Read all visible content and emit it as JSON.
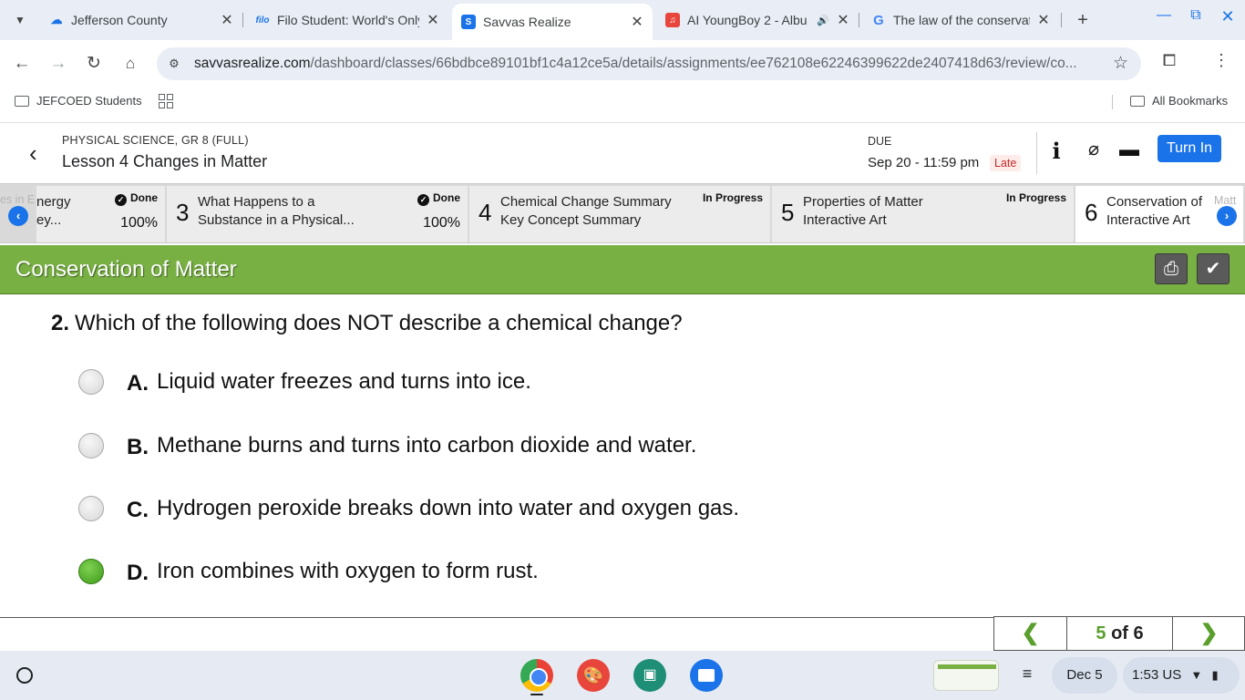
{
  "browser": {
    "tabs": [
      {
        "title": "Jefferson County",
        "favicon": "cloud-icon",
        "favicon_color": "#1a73e8",
        "active": false
      },
      {
        "title": "Filo Student: World's Only",
        "favicon": "filo-icon",
        "favicon_text": "filo",
        "favicon_color": "#1a73e8",
        "active": false
      },
      {
        "title": "Savvas Realize",
        "favicon": "savvas-icon",
        "favicon_text": "S",
        "favicon_color": "#1a73e8",
        "active": true
      },
      {
        "title": "AI YoungBoy 2 - Albu",
        "favicon": "music-icon",
        "favicon_color": "#e8453c",
        "active": false,
        "audio": true
      },
      {
        "title": "The law of the conservat",
        "favicon": "google-icon",
        "favicon_text": "G",
        "favicon_color": "#4285f4",
        "active": false
      }
    ],
    "new_tab": "+",
    "url_host": "savvasrealize.com",
    "url_path": "/dashboard/classes/66bdbce89101bf1c4a12ce5a/details/assignments/ee762108e62246399622de2407418d63/review/co..."
  },
  "bookmarks": {
    "items": [
      {
        "label": "JEFCOED Students",
        "icon": "folder-icon"
      }
    ],
    "all_bookmarks": "All Bookmarks"
  },
  "header": {
    "course": "PHYSICAL SCIENCE, GR 8 (FULL)",
    "lesson": "Lesson 4 Changes in Matter",
    "due_label": "DUE",
    "due_date": "Sep 20 - 11:59 pm",
    "late_badge": "Late",
    "turn_in": "Turn In",
    "icons": [
      "info-icon",
      "paperclip-icon",
      "comment-icon"
    ]
  },
  "steps": {
    "left_ghost": "es in E",
    "items": [
      {
        "num": "",
        "title_line1": "nergy",
        "title_line2": "ey...",
        "status": "Done",
        "percent": "100%"
      },
      {
        "num": "3",
        "title_line1": "What Happens to a",
        "title_line2": "Substance in a Physical...",
        "status": "Done",
        "percent": "100%"
      },
      {
        "num": "4",
        "title_line1": "Chemical Change Summary",
        "title_line2": "Key Concept Summary",
        "status": "In Progress",
        "percent": ""
      },
      {
        "num": "5",
        "title_line1": "Properties of Matter",
        "title_line2": "Interactive Art",
        "status": "In Progress",
        "percent": ""
      },
      {
        "num": "6",
        "title_line1": "Conservation of",
        "title_line2": "Interactive Art",
        "status": "",
        "percent": ""
      }
    ],
    "right_ghost": "Matt"
  },
  "activity": {
    "title": "Conservation of Matter",
    "accent": "#78b043"
  },
  "question": {
    "number": "2.",
    "text": "Which of the following does NOT describe a chemical change?",
    "options": [
      {
        "letter": "A.",
        "text": "Liquid water freezes and turns into ice.",
        "selected": false
      },
      {
        "letter": "B.",
        "text": "Methane burns and turns into carbon dioxide and water.",
        "selected": false
      },
      {
        "letter": "C.",
        "text": "Hydrogen peroxide breaks down into water and oxygen gas.",
        "selected": false
      },
      {
        "letter": "D.",
        "text": "Iron combines with oxygen to form rust.",
        "selected": true
      }
    ]
  },
  "pager": {
    "current": "5",
    "of_total": "of 6",
    "prev": "❮",
    "next": "❯"
  },
  "shelf": {
    "date": "Dec 5",
    "time": "1:53",
    "locale": "US",
    "apps": [
      "chrome-icon",
      "palette-icon",
      "classroom-icon",
      "files-icon"
    ]
  }
}
